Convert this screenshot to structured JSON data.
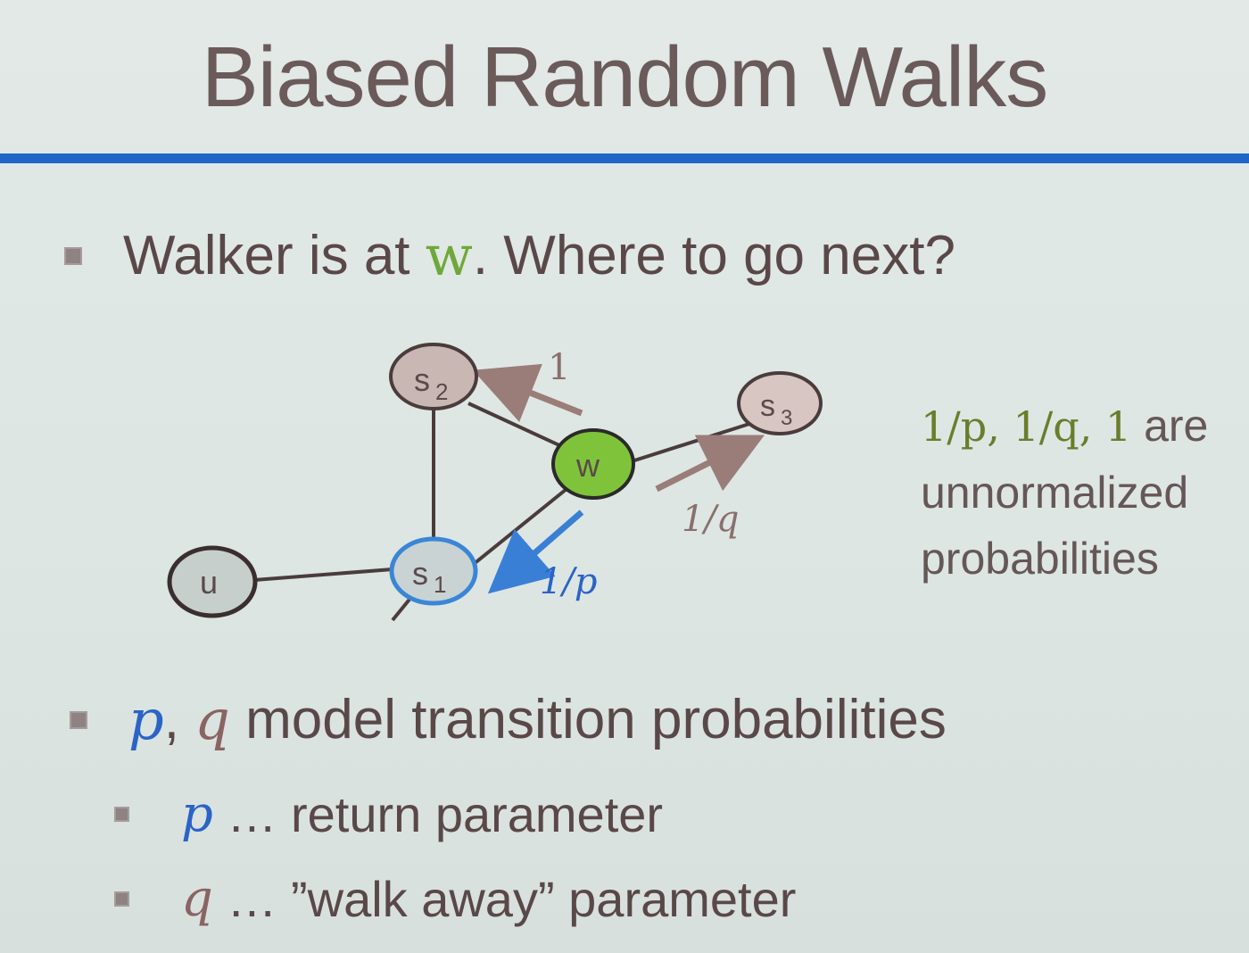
{
  "title": "Biased Random Walks",
  "bullets": {
    "walker_pre": "Walker is at ",
    "walker_var": "w",
    "walker_post": ". Where to go next?",
    "model_p": "p",
    "model_comma": ",",
    "model_q": "q",
    "model_text": " model transition probabilities",
    "p_var": "p",
    "p_text": " … return parameter",
    "q_var": "q",
    "q_text": " … ”walk away” parameter"
  },
  "note": {
    "math": "1/p, 1/q, 1",
    "line1_suffix": " are",
    "line2": "unnormalized",
    "line3": "probabilities"
  },
  "graph": {
    "nodes": {
      "s2": "s",
      "s2_sub": "2",
      "s3": "s",
      "s3_sub": "3",
      "w": "w",
      "s1": "s",
      "s1_sub": "1",
      "u": "u"
    },
    "edge_labels": {
      "to_s2": "1",
      "to_s3": "1/q",
      "to_s1": "1/p"
    }
  },
  "colors": {
    "accent_rule": "#1f66c9",
    "w_node": "#7fc33a",
    "s1_ring": "#3a86d6",
    "node_fill": "#c9b7b4",
    "p_color": "#2b63c6",
    "q_color": "#8a6363"
  }
}
